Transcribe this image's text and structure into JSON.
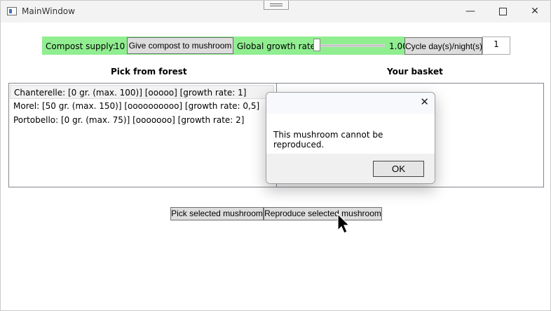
{
  "window": {
    "title": "MainWindow",
    "minimize_icon": "minimize-icon",
    "maximize_icon": "maximize-icon",
    "close_icon": "close-icon"
  },
  "toolbar": {
    "compost_label": "Compost supply:",
    "compost_value": "10",
    "give_compost_label": "Give compost to mushroom",
    "growth_rate_label": "Global growth rate:",
    "growth_rate_value": "1.00",
    "growth_rate_slider_fraction": 0.0,
    "cycle_label": "Cycle day(s)/night(s)",
    "cycle_value": "1",
    "background_color": "#90ee90"
  },
  "forest": {
    "header": "Pick from forest",
    "items": [
      "Chanterelle: [0 gr. (max. 100)] [ooooo] [growth rate: 1]",
      "Morel: [50 gr. (max. 150)] [oooooooooo] [growth rate: 0,5]",
      "Portobello: [0 gr. (max. 75)] [ooooooo] [growth rate: 2]"
    ]
  },
  "basket": {
    "header": "Your basket",
    "items": []
  },
  "actions": {
    "pick_label": "Pick selected mushroom",
    "reproduce_label": "Reproduce selected mushroom"
  },
  "dialog": {
    "message": "This mushroom cannot be reproduced.",
    "ok_label": "OK",
    "close_glyph": "✕"
  }
}
